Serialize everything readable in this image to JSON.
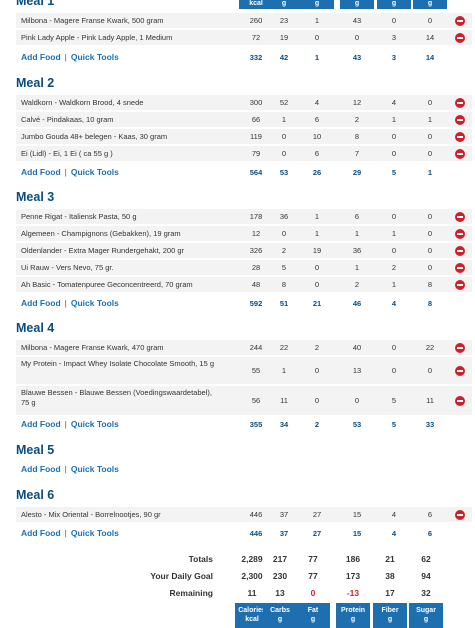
{
  "header": {
    "col_units": [
      "kcal",
      "g",
      "g",
      "g",
      "g",
      "g"
    ]
  },
  "meals": [
    {
      "title": "Meal 1",
      "entries": [
        {
          "name": "Milbona - Magere Franse Kwark, 500 gram",
          "values": [
            "260",
            "23",
            "1",
            "43",
            "0",
            "0"
          ]
        },
        {
          "name": "Pink Lady Apple - Pink Lady Apple, 1 Medium",
          "values": [
            "72",
            "19",
            "0",
            "0",
            "3",
            "14"
          ]
        }
      ],
      "totals": [
        "332",
        "42",
        "1",
        "43",
        "3",
        "14"
      ]
    },
    {
      "title": "Meal 2",
      "entries": [
        {
          "name": "Waldkorn - Waldkorn Brood, 4 snede",
          "values": [
            "300",
            "52",
            "4",
            "12",
            "4",
            "0"
          ]
        },
        {
          "name": "Calvé - Pindakaas, 10 gram",
          "values": [
            "66",
            "1",
            "6",
            "2",
            "1",
            "1"
          ]
        },
        {
          "name": "Jumbo Gouda 48+ belegen - Kaas, 30 gram",
          "values": [
            "119",
            "0",
            "10",
            "8",
            "0",
            "0"
          ]
        },
        {
          "name": "Ei (Lidl) - Ei, 1 Ei ( ca 55 g )",
          "values": [
            "79",
            "0",
            "6",
            "7",
            "0",
            "0"
          ]
        }
      ],
      "totals": [
        "564",
        "53",
        "26",
        "29",
        "5",
        "1"
      ]
    },
    {
      "title": "Meal 3",
      "entries": [
        {
          "name": "Penne Rigat - Italiensk Pasta, 50 g",
          "values": [
            "178",
            "36",
            "1",
            "6",
            "0",
            "0"
          ]
        },
        {
          "name": "Algemeen - Champignons (Gebakken), 19 gram",
          "values": [
            "12",
            "0",
            "1",
            "1",
            "1",
            "0"
          ]
        },
        {
          "name": "Oldenlander - Extra Mager Rundergehakt, 200 gr",
          "values": [
            "326",
            "2",
            "19",
            "36",
            "0",
            "0"
          ]
        },
        {
          "name": "Ui Rauw - Vers Nevo, 75 gr.",
          "values": [
            "28",
            "5",
            "0",
            "1",
            "2",
            "0"
          ]
        },
        {
          "name": "Ah Basic - Tomatenpuree Geconcentreerd, 70 gram",
          "values": [
            "48",
            "8",
            "0",
            "2",
            "1",
            "8"
          ]
        }
      ],
      "totals": [
        "592",
        "51",
        "21",
        "46",
        "4",
        "8"
      ]
    },
    {
      "title": "Meal 4",
      "entries": [
        {
          "name": "Milbona - Magere Franse Kwark, 470 gram",
          "values": [
            "244",
            "22",
            "2",
            "40",
            "0",
            "22"
          ]
        },
        {
          "name": "My Protein - Impact Whey Isolate Chocolate Smooth, 15 g",
          "values": [
            "55",
            "1",
            "0",
            "13",
            "0",
            "0"
          ]
        },
        {
          "name": "Blauwe Bessen - Blauwe Bessen (Voedingswaardetabel), 75 g",
          "values": [
            "56",
            "11",
            "0",
            "0",
            "5",
            "11"
          ]
        }
      ],
      "totals": [
        "355",
        "34",
        "2",
        "53",
        "5",
        "33"
      ]
    },
    {
      "title": "Meal 5",
      "entries": [],
      "totals": []
    },
    {
      "title": "Meal 6",
      "entries": [
        {
          "name": "Alesto - Mix Oriental - Borrelnootjes, 90 gr",
          "values": [
            "446",
            "37",
            "27",
            "15",
            "4",
            "6"
          ]
        }
      ],
      "totals": [
        "446",
        "37",
        "27",
        "15",
        "4",
        "6"
      ]
    }
  ],
  "links": {
    "add_food": "Add Food",
    "separator": "|",
    "quick_tools": "Quick Tools"
  },
  "summary": {
    "rows": [
      {
        "label": "Totals",
        "values": [
          "2,289",
          "217",
          "77",
          "186",
          "21",
          "62"
        ]
      },
      {
        "label": "Your Daily Goal",
        "values": [
          "2,300",
          "230",
          "77",
          "173",
          "38",
          "94"
        ]
      },
      {
        "label": "Remaining",
        "values": [
          "11",
          "13",
          "0",
          "-13",
          "17",
          "32"
        ]
      }
    ]
  },
  "footer": {
    "columns": [
      {
        "name": "Calories",
        "unit": "kcal"
      },
      {
        "name": "Carbs",
        "unit": "g"
      },
      {
        "name": "Fat",
        "unit": "g"
      },
      {
        "name": "Protein",
        "unit": "g"
      },
      {
        "name": "Fiber",
        "unit": "g"
      },
      {
        "name": "Sugar",
        "unit": "g"
      }
    ]
  },
  "colors": {
    "accent": "#1d6fb0",
    "title": "#0a4c80",
    "negative": "#d01f2b"
  }
}
